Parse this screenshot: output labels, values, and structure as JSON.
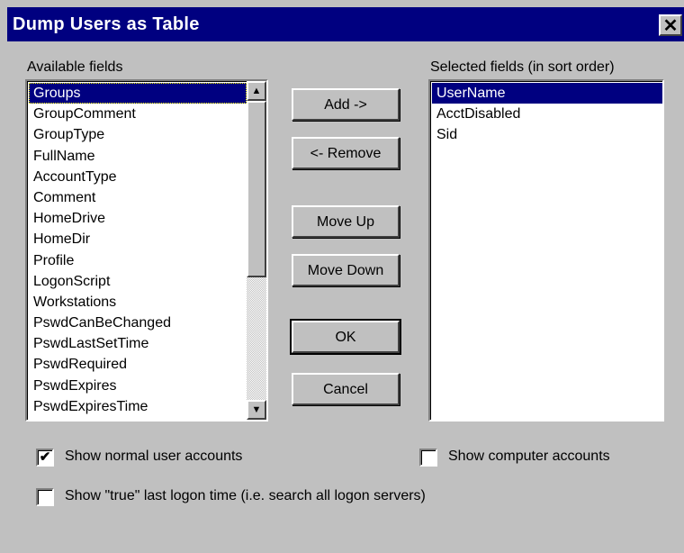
{
  "window": {
    "title": "Dump Users as Table",
    "close_glyph": "✕"
  },
  "available": {
    "label": "Available fields",
    "items": [
      "Groups",
      "GroupComment",
      "GroupType",
      "FullName",
      "AccountType",
      "Comment",
      "HomeDrive",
      "HomeDir",
      "Profile",
      "LogonScript",
      "Workstations",
      "PswdCanBeChanged",
      "PswdLastSetTime",
      "PswdRequired",
      "PswdExpires",
      "PswdExpiresTime"
    ],
    "selected_index": 0
  },
  "selected": {
    "label": "Selected fields (in sort order)",
    "items": [
      "UserName",
      "AcctDisabled",
      "Sid"
    ],
    "selected_index": 0
  },
  "buttons": {
    "add": "Add ->",
    "remove": "<- Remove",
    "move_up": "Move Up",
    "move_down": "Move Down",
    "ok": "OK",
    "cancel": "Cancel"
  },
  "options": {
    "show_normal": {
      "label": "Show normal user accounts",
      "checked": true
    },
    "show_computer": {
      "label": "Show computer accounts",
      "checked": false
    },
    "show_true_logon": {
      "label": "Show \"true\" last logon time (i.e. search all logon servers)",
      "checked": false
    }
  },
  "icons": {
    "scroll_up": "▲",
    "scroll_down": "▼",
    "check_mark": "✔"
  },
  "colors": {
    "title_bar": "#000080",
    "selection": "#000080",
    "face": "#c0c0c0"
  }
}
